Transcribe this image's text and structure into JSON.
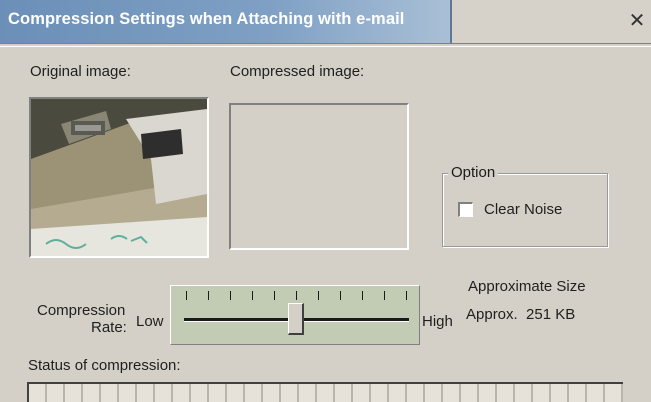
{
  "window": {
    "title": "Compression Settings when Attaching with e-mail",
    "close_glyph": "✕"
  },
  "preview": {
    "original_label": "Original image:",
    "compressed_label": "Compressed image:"
  },
  "option": {
    "group_title": "Option",
    "clear_noise_label": "Clear Noise",
    "clear_noise_checked": false
  },
  "compression": {
    "rate_label_line1": "Compression",
    "rate_label_line2": "Rate:",
    "low_label": "Low",
    "high_label": "High",
    "slider_level": 0.5,
    "tick_count": 11
  },
  "size": {
    "heading": "Approximate Size",
    "value": "Approx.  251 KB"
  },
  "status": {
    "label": "Status of compression:",
    "progress": 0
  },
  "colors": {
    "title_gradient_start": "#6b8fb8",
    "dialog_bg": "#d4d0c8",
    "slider_bg": "#c2ccb4"
  }
}
